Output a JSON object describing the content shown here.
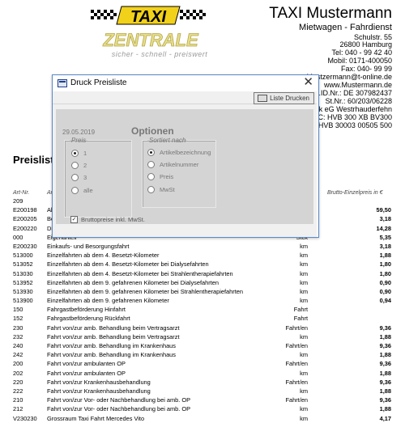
{
  "letterhead": {
    "logo_word": "TAXI",
    "logo_sub": "ZENTRALE",
    "tagline": "sicher - schnell - preiswert",
    "company": "TAXI Mustermann",
    "subtitle": "Mietwagen - Fahrdienst",
    "address_lines": [
      "Schulstr. 55",
      "26800 Hamburg",
      "Tel: 040 - 99 42 40",
      "Mobil: 0171-400050",
      "Fax: 040- 99 99",
      "Mustzermann@t-online.de",
      "www.Mustermann.de",
      "Ust.ID.Nr.: DE 307982437",
      "St.Nr.: 60/203/06228",
      "ank eG Westrhauderfehn",
      "BIC: HVB 300 XB BV300",
      "E HVB 30003 00505 500"
    ]
  },
  "document": {
    "title": "Preisliste",
    "columns": {
      "nr": "Art-Nr.",
      "desc": "Art",
      "price": "Brutto-Einzelpreis in €"
    },
    "rows": [
      {
        "nr": "209",
        "desc": "",
        "unit": "",
        "price": ""
      },
      {
        "nr": "E200198",
        "desc": "Ab",
        "unit": "",
        "price": "59,50"
      },
      {
        "nr": "E200205",
        "desc": "Bo",
        "unit": "",
        "price": "3,18"
      },
      {
        "nr": "E200220",
        "desc": "Dia",
        "unit": "",
        "price": "14,28"
      },
      {
        "nr": "000",
        "desc": "Eigenanteil",
        "unit": "Stck",
        "price": "5,35"
      },
      {
        "nr": "E200230",
        "desc": "Einkaufs- und Besorgungsfahrt",
        "unit": "km",
        "price": "3,18"
      },
      {
        "nr": "513000",
        "desc": "Einzelfahrten ab dem 4. Besetzt-Kilometer",
        "unit": "km",
        "price": "1,88"
      },
      {
        "nr": "513052",
        "desc": "Einzelfahrten ab dem 4. Besetzt-Kilometer bei Dialysefahrten",
        "unit": "km",
        "price": "1,80"
      },
      {
        "nr": "513030",
        "desc": "Einzelfahrten ab dem 4. Besetzt-Kilometer bei Strahlentherapiefahrten",
        "unit": "km",
        "price": "1,80"
      },
      {
        "nr": "513952",
        "desc": "Einzelfahrten ab dem 9. gefahrenen Kilometer bei Dialysefahrten",
        "unit": "km",
        "price": "0,90"
      },
      {
        "nr": "513930",
        "desc": "Einzelfahrten ab dem 9. gefahrenen Kilometer bei Strahlentherapiefahrten",
        "unit": "km",
        "price": "0,90"
      },
      {
        "nr": "513900",
        "desc": "Einzelfahrten ab dem 9. gefahrenen Kilometer",
        "unit": "km",
        "price": "0,94"
      },
      {
        "nr": "150",
        "desc": "Fahrgastbeförderung Hinfahrt",
        "unit": "Fahrt",
        "price": ""
      },
      {
        "nr": "152",
        "desc": "Fahrgastbeförderung Rückfahrt",
        "unit": "Fahrt",
        "price": ""
      },
      {
        "nr": "230",
        "desc": "Fahrt von/zur amb. Behandlung beim Vertragsarzt",
        "unit": "Fahrt/en",
        "price": "9,36"
      },
      {
        "nr": "232",
        "desc": "Fahrt von/zur amb. Behandlung beim Vertragsarzt",
        "unit": "km",
        "price": "1,88"
      },
      {
        "nr": "240",
        "desc": "Fahrt von/zur amb. Behandlung im Krankenhaus",
        "unit": "Fahrt/en",
        "price": "9,36"
      },
      {
        "nr": "242",
        "desc": "Fahrt von/zur amb. Behandlung im Krankenhaus",
        "unit": "km",
        "price": "1,88"
      },
      {
        "nr": "200",
        "desc": "Fahrt von/zur ambulanten OP",
        "unit": "Fahrt/en",
        "price": "9,36"
      },
      {
        "nr": "202",
        "desc": "Fahrt von/zur ambulanten OP",
        "unit": "km",
        "price": "1,88"
      },
      {
        "nr": "220",
        "desc": "Fahrt von/zur Krankenhausbehandlung",
        "unit": "Fahrt/en",
        "price": "9,36"
      },
      {
        "nr": "222",
        "desc": "Fahrt von/zur Krankenhausbehandlung",
        "unit": "km",
        "price": "1,88"
      },
      {
        "nr": "210",
        "desc": "Fahrt von/zur Vor- oder Nachbehandlung bei amb. OP",
        "unit": "Fahrt/en",
        "price": "9,36"
      },
      {
        "nr": "212",
        "desc": "Fahrt von/zur Vor- oder Nachbehandlung bei amb. OP",
        "unit": "km",
        "price": "1,88"
      },
      {
        "nr": "V230230",
        "desc": "Grossraum Taxi Fahrt Mercedes Vito",
        "unit": "km",
        "price": "4,17"
      }
    ]
  },
  "dialog": {
    "title": "Druck Preisliste",
    "close_glyph": "✕",
    "print_button": "Liste Drucken",
    "date": "29.05.2019",
    "options_heading": "Optionen",
    "price_group": {
      "legend": "Preis",
      "options": [
        "1",
        "2",
        "3",
        "alle"
      ],
      "selected_index": 0
    },
    "sort_group": {
      "legend": "Sortiert nach",
      "options": [
        "Artikelbezeichnung",
        "Artikelnummer",
        "Preis",
        "MwSt"
      ],
      "selected_index": 0
    },
    "checkbox_label": "Bruttopreise inkl. MwSt.",
    "checkbox_checked": true,
    "checkbox_glyph": "✓"
  }
}
